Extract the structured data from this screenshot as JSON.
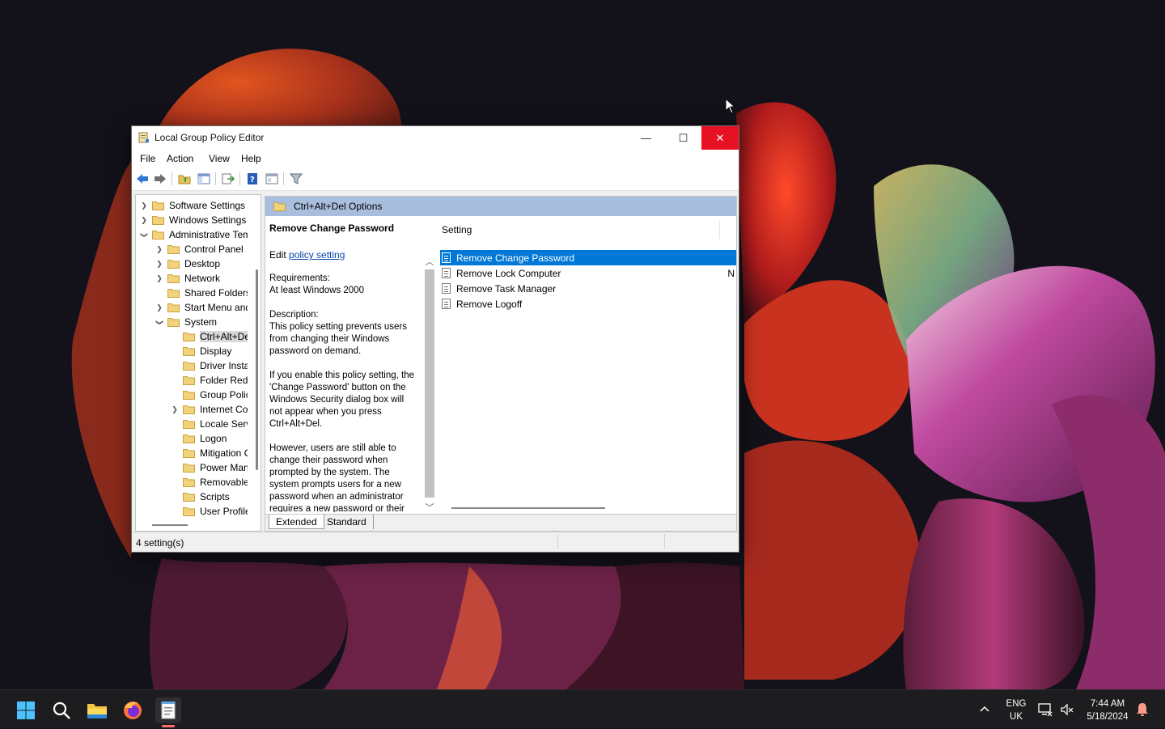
{
  "window": {
    "title": "Local Group Policy Editor",
    "controls": {
      "minimize": "—",
      "maximize": "☐",
      "close": "✕"
    }
  },
  "menu": [
    "File",
    "Action",
    "View",
    "Help"
  ],
  "toolbar": {
    "icons": [
      "back-arrow-icon",
      "forward-arrow-icon",
      "up-folder-icon",
      "show-hide-tree-icon",
      "export-list-icon",
      "help-icon",
      "properties-icon",
      "filter-icon"
    ]
  },
  "tree": {
    "items": [
      {
        "label": "Software Settings",
        "level": 1,
        "expander": "collapsed"
      },
      {
        "label": "Windows Settings",
        "level": 1,
        "expander": "collapsed"
      },
      {
        "label": "Administrative Templates",
        "level": 1,
        "expander": "expanded"
      },
      {
        "label": "Control Panel",
        "level": 2,
        "expander": "collapsed"
      },
      {
        "label": "Desktop",
        "level": 2,
        "expander": "collapsed"
      },
      {
        "label": "Network",
        "level": 2,
        "expander": "collapsed"
      },
      {
        "label": "Shared Folders",
        "level": 2,
        "expander": "none"
      },
      {
        "label": "Start Menu and Taskbar",
        "level": 2,
        "expander": "collapsed"
      },
      {
        "label": "System",
        "level": 2,
        "expander": "expanded"
      },
      {
        "label": "Ctrl+Alt+Del Options",
        "level": 3,
        "expander": "none",
        "selected": true
      },
      {
        "label": "Display",
        "level": 3,
        "expander": "none"
      },
      {
        "label": "Driver Installation",
        "level": 3,
        "expander": "none"
      },
      {
        "label": "Folder Redirection",
        "level": 3,
        "expander": "none"
      },
      {
        "label": "Group Policy",
        "level": 3,
        "expander": "none"
      },
      {
        "label": "Internet Communication Management",
        "level": 3,
        "expander": "collapsed"
      },
      {
        "label": "Locale Services",
        "level": 3,
        "expander": "none"
      },
      {
        "label": "Logon",
        "level": 3,
        "expander": "none"
      },
      {
        "label": "Mitigation Options",
        "level": 3,
        "expander": "none"
      },
      {
        "label": "Power Management",
        "level": 3,
        "expander": "none"
      },
      {
        "label": "Removable Storage Access",
        "level": 3,
        "expander": "none"
      },
      {
        "label": "Scripts",
        "level": 3,
        "expander": "none"
      },
      {
        "label": "User Profiles",
        "level": 3,
        "expander": "none"
      }
    ]
  },
  "header": {
    "title": "Ctrl+Alt+Del Options"
  },
  "description": {
    "title": "Remove Change Password",
    "edit_prefix": "Edit ",
    "edit_link": "policy setting",
    "paragraphs": [
      "Requirements:\nAt least Windows 2000",
      "Description:\nThis policy setting prevents users from changing their Windows password on demand.",
      "If you enable this policy setting, the 'Change Password' button on the Windows Security dialog box will not appear when you press Ctrl+Alt+Del.",
      "However, users are still able to change their password when prompted by the system. The system prompts users for a new password when an administrator requires a new password or their"
    ]
  },
  "list": {
    "column": "Setting",
    "rows": [
      {
        "label": "Remove Change Password",
        "state": "",
        "selected": true
      },
      {
        "label": "Remove Lock Computer",
        "state": "N",
        "selected": false
      },
      {
        "label": "Remove Task Manager",
        "state": "",
        "selected": false
      },
      {
        "label": "Remove Logoff",
        "state": "",
        "selected": false
      }
    ]
  },
  "tabs": [
    {
      "label": "Extended",
      "active": true
    },
    {
      "label": "Standard",
      "active": false
    }
  ],
  "status": {
    "text": "4 setting(s)"
  },
  "taskbar": {
    "apps": [
      "windows-start-icon",
      "search-icon",
      "file-explorer-icon",
      "firefox-icon",
      "notepad-icon"
    ],
    "tray": {
      "lang_line1": "ENG",
      "lang_line2": "UK",
      "time": "7:44 AM",
      "date": "5/18/2024"
    }
  },
  "colors": {
    "selection": "#0078d7",
    "header_strip": "#a9bedc",
    "close_button": "#e81123",
    "link": "#0645ad"
  }
}
